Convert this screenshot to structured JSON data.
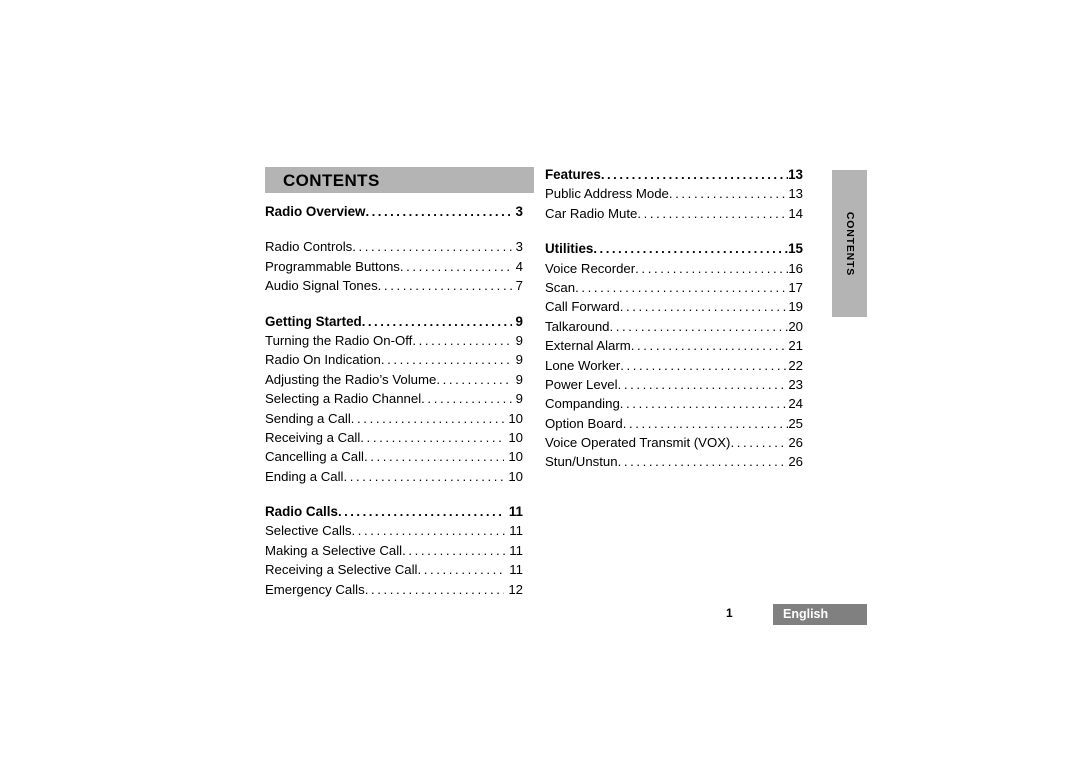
{
  "header": {
    "title": "CONTENTS"
  },
  "side_tab": {
    "label": "CONTENTS"
  },
  "footer": {
    "page_number": "1",
    "language": "English"
  },
  "colors": {
    "header_bar": "#b4b4b4",
    "side_tab": "#b4b4b4",
    "language_badge": "#808080",
    "text": "#000000",
    "badge_text": "#ffffff"
  },
  "columns": {
    "left": [
      {
        "label": "Radio Overview",
        "page": "3",
        "bold": true
      },
      {
        "label": "Radio Controls",
        "page": "3",
        "bold": false
      },
      {
        "label": "Programmable Buttons",
        "page": "4",
        "bold": false
      },
      {
        "label": "Audio Signal Tones",
        "page": "7",
        "bold": false
      },
      {
        "label": "Getting Started",
        "page": "9",
        "bold": true
      },
      {
        "label": "Turning the Radio On-Off",
        "page": "9",
        "bold": false
      },
      {
        "label": "Radio On Indication",
        "page": "9",
        "bold": false
      },
      {
        "label": "Adjusting the Radio’s Volume",
        "page": "9",
        "bold": false
      },
      {
        "label": "Selecting a Radio Channel",
        "page": "9",
        "bold": false
      },
      {
        "label": "Sending a Call",
        "page": "10",
        "bold": false
      },
      {
        "label": "Receiving a Call",
        "page": "10",
        "bold": false
      },
      {
        "label": "Cancelling a Call",
        "page": "10",
        "bold": false
      },
      {
        "label": "Ending a Call",
        "page": "10",
        "bold": false
      },
      {
        "label": "Radio Calls",
        "page": "11",
        "bold": true
      },
      {
        "label": "Selective Calls",
        "page": "11",
        "bold": false
      },
      {
        "label": "Making a Selective Call",
        "page": "11",
        "bold": false
      },
      {
        "label": "Receiving a Selective Call",
        "page": "11",
        "bold": false
      },
      {
        "label": "Emergency Calls",
        "page": "12",
        "bold": false
      }
    ],
    "right": [
      {
        "label": "Features",
        "page": "13",
        "bold": true
      },
      {
        "label": "Public Address Mode",
        "page": "13",
        "bold": false
      },
      {
        "label": "Car Radio Mute",
        "page": "14",
        "bold": false
      },
      {
        "label": "Utilities",
        "page": "15",
        "bold": true
      },
      {
        "label": "Voice Recorder",
        "page": "16",
        "bold": false
      },
      {
        "label": "Scan",
        "page": "17",
        "bold": false
      },
      {
        "label": "Call Forward",
        "page": "19",
        "bold": false
      },
      {
        "label": "Talkaround",
        "page": "20",
        "bold": false
      },
      {
        "label": "External Alarm",
        "page": "21",
        "bold": false
      },
      {
        "label": "Lone Worker",
        "page": "22",
        "bold": false
      },
      {
        "label": "Power Level",
        "page": "23",
        "bold": false
      },
      {
        "label": "Companding",
        "page": "24",
        "bold": false
      },
      {
        "label": "Option Board",
        "page": "25",
        "bold": false
      },
      {
        "label": "Voice Operated Transmit (VOX)",
        "page": "26",
        "bold": false
      },
      {
        "label": "Stun/Unstun",
        "page": "26",
        "bold": false
      }
    ]
  },
  "layout": {
    "left_gaps_after_index": [
      0,
      3,
      12
    ],
    "right_gaps_after_index": [
      2
    ]
  }
}
